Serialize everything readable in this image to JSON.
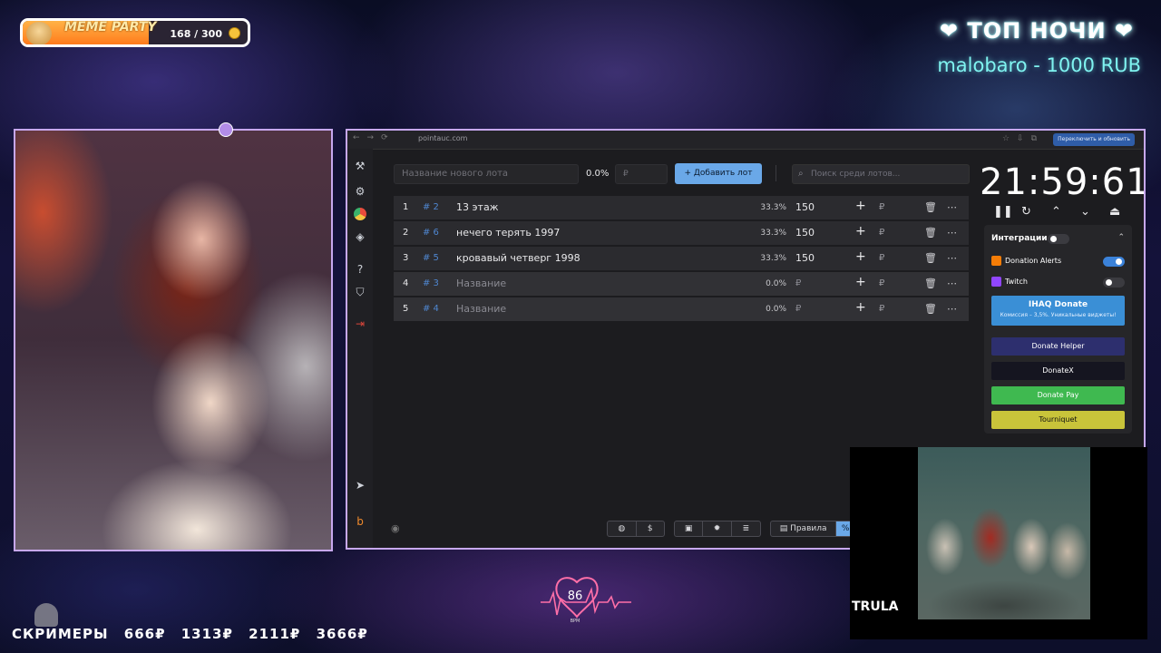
{
  "meme_party": {
    "title": "MEME PARTY",
    "count": "168 / 300",
    "progress": 0.56
  },
  "top_night": {
    "title": "❤ ТОП НОЧИ ❤",
    "leader": "malobaro - 1000 RUB"
  },
  "browser": {
    "url": "pointauc.com",
    "profile_button": "Переключить и обновить",
    "new_lot_placeholder": "Название нового лота",
    "percent": "0.0%",
    "amount_placeholder": "₽",
    "add_button": "Добавить лот",
    "search_placeholder": "Поиск среди лотов...",
    "lots": [
      {
        "num": "1",
        "id": "# 2",
        "name": "13 этаж",
        "pct": "33.3%",
        "amount": "150",
        "empty": false
      },
      {
        "num": "2",
        "id": "# 6",
        "name": "нечего терять 1997",
        "pct": "33.3%",
        "amount": "150",
        "empty": false
      },
      {
        "num": "3",
        "id": "# 5",
        "name": "кровавый четверг 1998",
        "pct": "33.3%",
        "amount": "150",
        "empty": false
      },
      {
        "num": "4",
        "id": "# 3",
        "name": "Название",
        "pct": "0.0%",
        "amount": "₽",
        "empty": true
      },
      {
        "num": "5",
        "id": "# 4",
        "name": "Название",
        "pct": "0.0%",
        "amount": "₽",
        "empty": true
      }
    ],
    "plus": "+",
    "rub": "₽",
    "timer": "21:59:61",
    "integrations": {
      "title": "Интеграции",
      "donation_alerts": "Donation Alerts",
      "twitch": "Twitch",
      "ihaq_title": "IHAQ Donate",
      "ihaq_sub": "Комиссия – 3,5%. Уникальные виджеты!",
      "donate_helper": "Donate Helper",
      "donatex": "DonateX",
      "donate_pay": "Donate Pay",
      "tourniquet": "Tourniquet"
    },
    "rules_button": "Правила",
    "bottom_percent": "%"
  },
  "video": {
    "label": "TRULA"
  },
  "heart": {
    "bpm": "86",
    "unit": "BPM"
  },
  "screamers": {
    "label": "СКРИМЕРЫ",
    "prices": [
      "666₽",
      "1313₽",
      "2111₽",
      "3666₽"
    ]
  },
  "colors": {
    "accent": "#6aa8e8",
    "frame": "#c7a8ef",
    "neon": "#7ff3f0"
  }
}
